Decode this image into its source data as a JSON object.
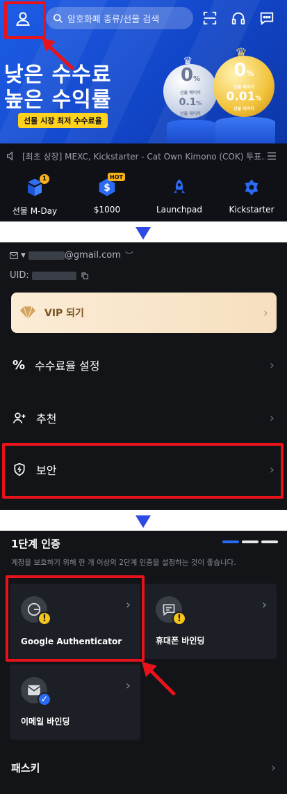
{
  "banner": {
    "search_placeholder": "암호화폐 종류/선물 검색",
    "headline_line1": "낮은 수수료",
    "headline_line2": "높은 수익률",
    "tagline": "선물 시장 최저 수수료율",
    "coin_silver": {
      "percent": "0",
      "label_top": "선물 메이커",
      "value": "0.1",
      "label_bottom": "선물 테이커"
    },
    "coin_gold": {
      "percent": "0",
      "label_top": "선물 메이커",
      "value": "0.01",
      "label_bottom": "선물 테이커"
    }
  },
  "news": {
    "text": "[최초 상장] MEXC, Kickstarter - Cat Own Kimono (COK) 투표..."
  },
  "quick_links": [
    {
      "label": "선물 M-Day",
      "badge": "1"
    },
    {
      "label": "$1000",
      "badge": "HOT"
    },
    {
      "label": "Launchpad",
      "badge": ""
    },
    {
      "label": "Kickstarter",
      "badge": ""
    }
  ],
  "account": {
    "email": "@gmail.com",
    "uid_label": "UID:",
    "vip_label": "VIP 되기",
    "menu": [
      {
        "label": "수수료율 설정"
      },
      {
        "label": "추천"
      },
      {
        "label": "보안"
      }
    ]
  },
  "security": {
    "title": "1단계 인증",
    "description": "계정을 보호하기 위해 한 개 이상의 2단계 인증을 설정하는 것이 좋습니다.",
    "progress_steps": 3,
    "progress_completed": 1,
    "cards": [
      {
        "label": "Google Authenticator",
        "status": "warning"
      },
      {
        "label": "휴대폰 바인딩",
        "status": "warning"
      },
      {
        "label": "이메일 바인딩",
        "status": "done"
      }
    ],
    "passkey_label": "패스키"
  },
  "colors": {
    "accent_blue": "#2f49e3",
    "highlight_red": "#e8131a",
    "warning_yellow": "#f5c518",
    "done_blue": "#2a6af5"
  },
  "icons": {
    "avatar": "user-icon",
    "scan": "scan-icon",
    "support": "headset-icon",
    "messages": "chat-icon",
    "speaker": "speaker-icon",
    "menu": "list-icon"
  }
}
